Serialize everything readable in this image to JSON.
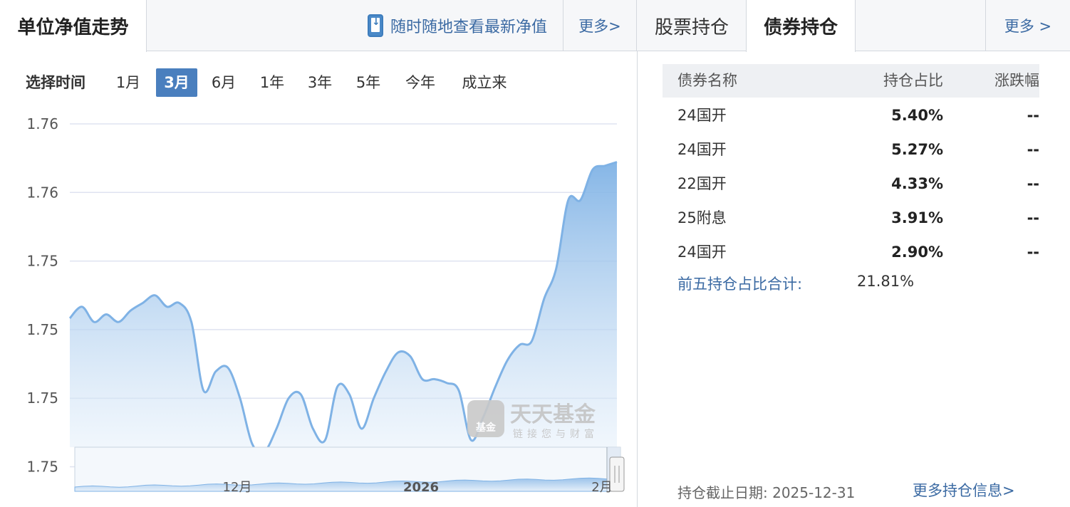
{
  "header": {
    "nav_tab_title": "单位净值走势",
    "app_link_label": "随时随地查看最新净值",
    "more_left": "更多>",
    "tab_stock": "股票持仓",
    "tab_bond": "债券持仓",
    "more_right": "更多 >"
  },
  "time_selector": {
    "label": "选择时间",
    "ranges": [
      "1月",
      "3月",
      "6月",
      "1年",
      "3年",
      "5年",
      "今年",
      "成立来"
    ],
    "active": "3月"
  },
  "chart_data": {
    "type": "area",
    "title": "",
    "xlabel": "",
    "ylabel": "",
    "y_tick_labels": [
      "1.76",
      "1.76",
      "1.75",
      "1.75",
      "1.75",
      "1.75"
    ],
    "grid": true,
    "line_color": "#7fb2e5",
    "fill_color": "#a9cdf0",
    "series": [
      {
        "values": [
          1.7484,
          1.7487,
          1.7483,
          1.7485,
          1.7483,
          1.7486,
          1.7488,
          1.749,
          1.7487,
          1.7488,
          1.7483,
          1.7465,
          1.747,
          1.7471,
          1.7463,
          1.7451,
          1.7449,
          1.7455,
          1.7463,
          1.7464,
          1.7455,
          1.7452,
          1.7466,
          1.7464,
          1.7455,
          1.7463,
          1.747,
          1.7475,
          1.7474,
          1.7468,
          1.7468,
          1.7467,
          1.7465,
          1.7452,
          1.7458,
          1.7466,
          1.7473,
          1.7477,
          1.7478,
          1.7489,
          1.7497,
          1.7515,
          1.7515,
          1.7523,
          1.7524,
          1.7525
        ]
      }
    ],
    "navigator": {
      "x_labels": [
        "12月",
        "2026",
        "2月"
      ]
    }
  },
  "watermark": {
    "brand": "天天基金",
    "slogan": "链接您与财富",
    "badge": "基金"
  },
  "bond_table": {
    "columns": [
      "债券名称",
      "持仓占比",
      "涨跌幅"
    ],
    "rows": [
      {
        "name": "24国开",
        "pct": "5.40%",
        "change": "--"
      },
      {
        "name": "24国开",
        "pct": "5.27%",
        "change": "--"
      },
      {
        "name": "22国开",
        "pct": "4.33%",
        "change": "--"
      },
      {
        "name": "25附息",
        "pct": "3.91%",
        "change": "--"
      },
      {
        "name": "24国开",
        "pct": "2.90%",
        "change": "--"
      }
    ],
    "summary_label": "前五持仓占比合计:",
    "summary_value": "21.81%",
    "as_of": "持仓截止日期: 2025-12-31",
    "more_info": "更多持仓信息>"
  }
}
